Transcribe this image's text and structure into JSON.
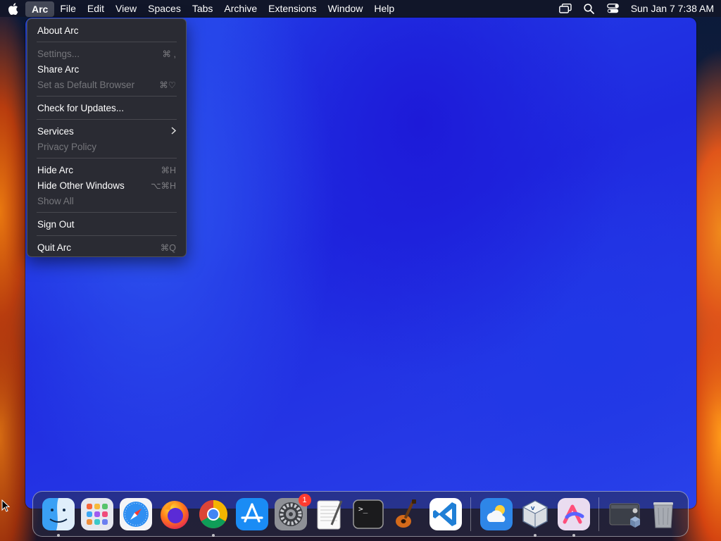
{
  "menubar": {
    "apple_icon": "apple-icon",
    "items": [
      "Arc",
      "File",
      "Edit",
      "View",
      "Spaces",
      "Tabs",
      "Archive",
      "Extensions",
      "Window",
      "Help"
    ],
    "active_index": 0,
    "status_icons": [
      "screen-mirroring-icon",
      "search-icon",
      "control-center-icon"
    ],
    "clock": "Sun Jan 7  7:38 AM"
  },
  "arc_menu": {
    "about": "About Arc",
    "settings": {
      "label": "Settings...",
      "shortcut": "⌘ ,"
    },
    "share": "Share Arc",
    "default_browser": {
      "label": "Set as Default Browser",
      "shortcut": "⌘♡"
    },
    "check_updates": "Check for Updates...",
    "services": "Services",
    "privacy": "Privacy Policy",
    "hide_arc": {
      "label": "Hide Arc",
      "shortcut": "⌘H"
    },
    "hide_others": {
      "label": "Hide Other Windows",
      "shortcut": "⌥⌘H"
    },
    "show_all": "Show All",
    "sign_out": "Sign Out",
    "quit": {
      "label": "Quit Arc",
      "shortcut": "⌘Q"
    }
  },
  "dock": {
    "apps": [
      {
        "name": "Finder",
        "icon": "finder-icon",
        "running": true
      },
      {
        "name": "Launchpad",
        "icon": "launchpad-icon",
        "running": false
      },
      {
        "name": "Safari",
        "icon": "safari-icon",
        "running": false
      },
      {
        "name": "Firefox",
        "icon": "firefox-icon",
        "running": false
      },
      {
        "name": "Chrome",
        "icon": "chrome-icon",
        "running": true
      },
      {
        "name": "App Store",
        "icon": "app-store-icon",
        "running": false
      },
      {
        "name": "System Settings",
        "icon": "system-settings-icon",
        "running": false,
        "badge": "1"
      },
      {
        "name": "TextEdit",
        "icon": "textedit-icon",
        "running": false
      },
      {
        "name": "Terminal",
        "icon": "terminal-icon",
        "running": false
      },
      {
        "name": "GarageBand",
        "icon": "garageband-icon",
        "running": false
      },
      {
        "name": "VS Code",
        "icon": "vscode-icon",
        "running": false
      },
      {
        "name": "Weather",
        "icon": "weather-icon",
        "running": false
      },
      {
        "name": "VirtualBox",
        "icon": "virtualbox-icon",
        "running": true
      },
      {
        "name": "Arc",
        "icon": "arc-icon",
        "running": true
      },
      {
        "name": "Downloads",
        "icon": "downloads-stack-icon",
        "running": false
      },
      {
        "name": "Trash",
        "icon": "trash-icon",
        "running": false
      }
    ],
    "settings_badge": "1"
  },
  "colors": {
    "window_blue": "#2447ea",
    "badge_red": "#ff3b30"
  }
}
